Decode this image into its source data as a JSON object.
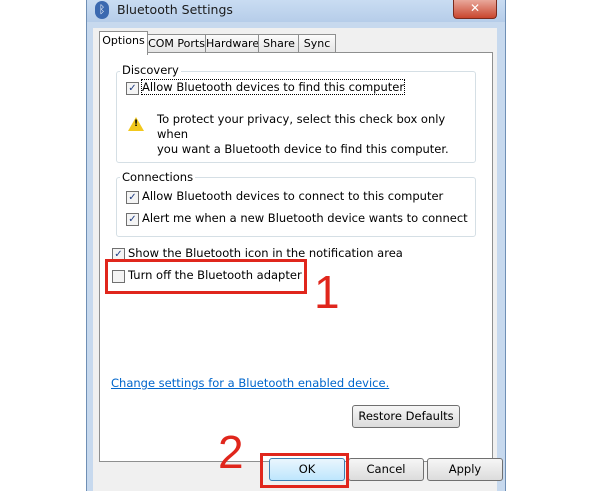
{
  "window": {
    "title": "Bluetooth Settings",
    "close_glyph": "✕"
  },
  "tabs": [
    "Options",
    "COM Ports",
    "Hardware",
    "Share",
    "Sync"
  ],
  "active_tab": "Options",
  "discovery": {
    "group_title": "Discovery",
    "allow_find_label": "Allow Bluetooth devices to find this computer",
    "allow_find_checked": true,
    "warning_line1": "To protect your privacy, select this check box only when",
    "warning_line2": "you want a Bluetooth device to find this computer."
  },
  "connections": {
    "group_title": "Connections",
    "allow_connect_label": "Allow Bluetooth devices to connect to this computer",
    "allow_connect_checked": true,
    "alert_label": "Alert me when a new Bluetooth device wants to connect",
    "alert_checked": true
  },
  "show_icon_label": "Show the Bluetooth icon in the notification area",
  "show_icon_checked": true,
  "turn_off_label": "Turn off the Bluetooth adapter",
  "turn_off_checked": false,
  "change_settings_link": "Change settings for a Bluetooth enabled device.",
  "buttons": {
    "restore": "Restore Defaults",
    "ok": "OK",
    "cancel": "Cancel",
    "apply": "Apply"
  },
  "annotations": {
    "step1": "1",
    "step2": "2",
    "color": "#e0261c"
  },
  "colors": {
    "title_bar": "#b6cde9",
    "link": "#0066cc",
    "check": "#1f3c80"
  },
  "icons": {
    "title": "bluetooth-icon",
    "warning": "warning-icon",
    "close": "close-icon"
  }
}
